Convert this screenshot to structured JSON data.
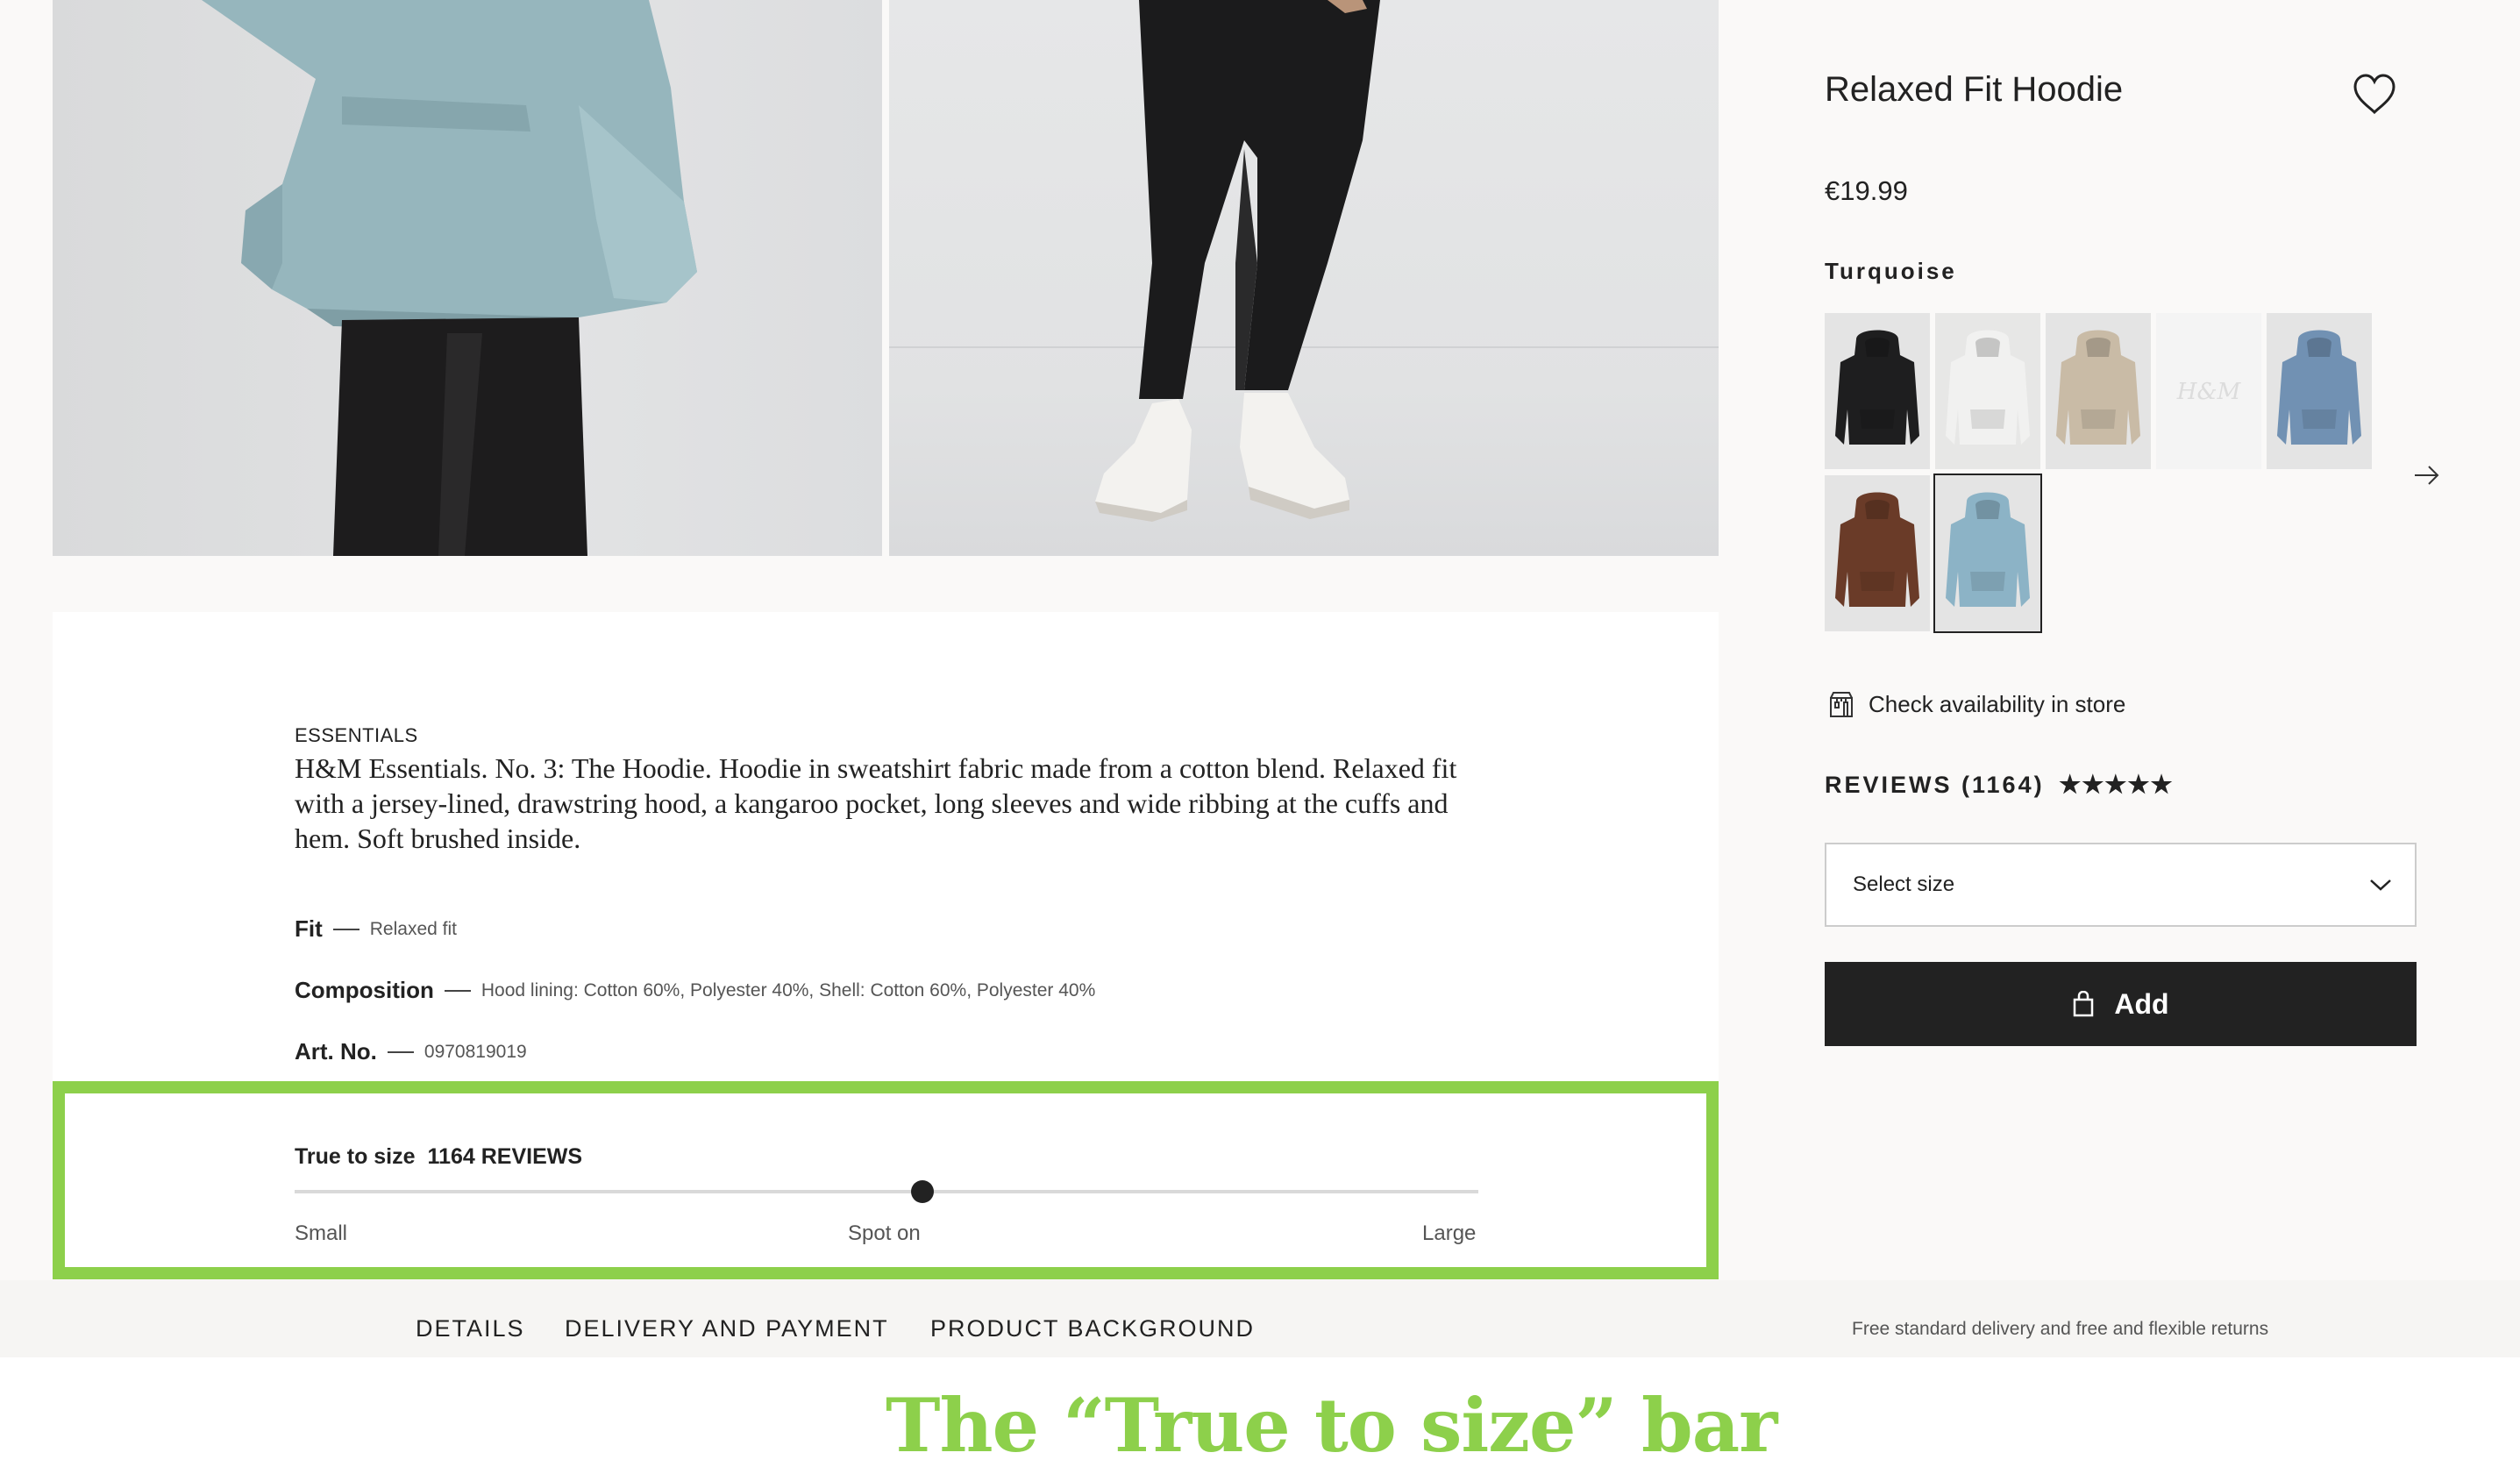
{
  "product": {
    "title": "Relaxed Fit Hoodie",
    "price": "€19.99",
    "selected_color": "Turquoise",
    "store_link": "Check availability in store",
    "reviews_label": "REVIEWS (1164)",
    "stars": "★★★★★",
    "size_placeholder": "Select size",
    "add_label": "Add"
  },
  "swatches": [
    {
      "name": "black",
      "color": "#1e1e1f"
    },
    {
      "name": "white",
      "color": "#f1f1f0"
    },
    {
      "name": "beige",
      "color": "#c9bba6"
    },
    {
      "name": "placeholder",
      "color": "#f4f4f4",
      "logo": "H&M"
    },
    {
      "name": "blue",
      "color": "#7191b3"
    },
    {
      "name": "brown",
      "color": "#6a3b28"
    },
    {
      "name": "turquoise",
      "color": "#8cb3c6",
      "selected": true
    }
  ],
  "description": {
    "category": "ESSENTIALS",
    "text": "H&M Essentials. No. 3: The Hoodie. Hoodie in sweatshirt fabric made from a cotton blend. Relaxed fit with a jersey-lined, drawstring hood, a kangaroo pocket, long sleeves and wide ribbing at the cuffs and hem. Soft brushed inside.",
    "specs": [
      {
        "key": "Fit",
        "value": "Relaxed fit"
      },
      {
        "key": "Composition",
        "value": "Hood lining: Cotton 60%, Polyester 40%, Shell: Cotton 60%, Polyester 40%"
      },
      {
        "key": "Art. No.",
        "value": "0970819019"
      }
    ]
  },
  "fit_scale": {
    "label": "True to size",
    "count": "1164 REVIEWS",
    "small": "Small",
    "spot_on": "Spot on",
    "large": "Large",
    "position": 0.53
  },
  "tabs": [
    "DETAILS",
    "DELIVERY AND PAYMENT",
    "PRODUCT BACKGROUND"
  ],
  "delivery_note": "Free standard delivery and free and flexible returns",
  "caption": "The “True to size” bar",
  "colors": {
    "highlight": "#8dd04b",
    "button": "#222222"
  }
}
